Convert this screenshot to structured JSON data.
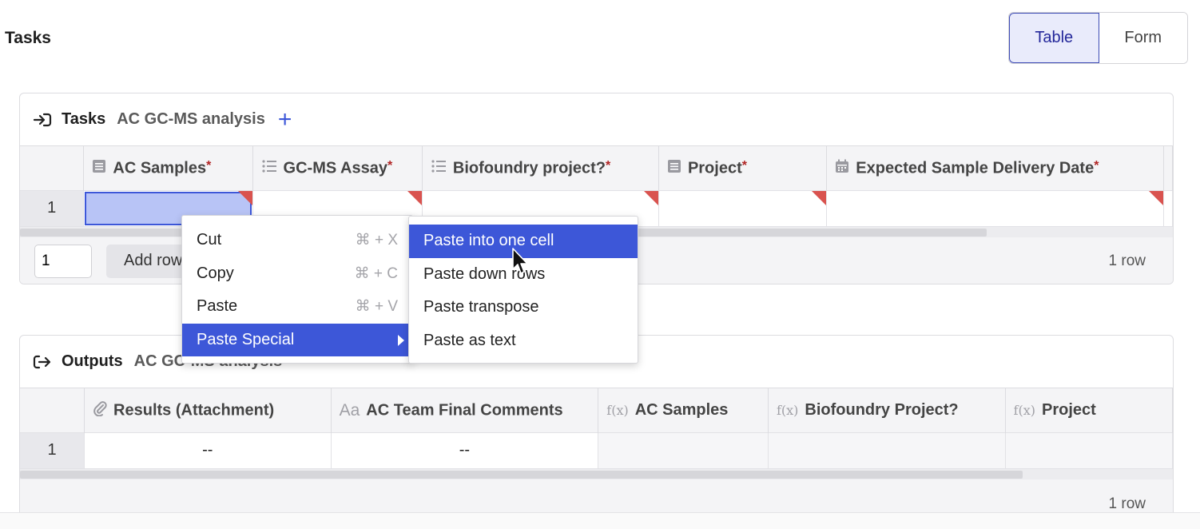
{
  "page": {
    "title": "Tasks"
  },
  "view_toggle": {
    "table_label": "Table",
    "form_label": "Form",
    "active": "Table"
  },
  "tasks_panel": {
    "kind": "Tasks",
    "subtitle": "AC GC-MS analysis",
    "add_symbol": "+",
    "columns": [
      {
        "label": "AC Samples",
        "required": "*",
        "icon": "table-icon"
      },
      {
        "label": "GC-MS Assay",
        "required": "*",
        "icon": "list-icon"
      },
      {
        "label": "Biofoundry project?",
        "required": "*",
        "icon": "list-icon"
      },
      {
        "label": "Project",
        "required": "*",
        "icon": "table-icon"
      },
      {
        "label": "Expected Sample Delivery Date",
        "required": "*",
        "icon": "calendar-icon"
      }
    ],
    "rows": [
      {
        "num": "1"
      }
    ],
    "footer": {
      "count_value": "1",
      "add_rows_label": "Add rows",
      "row_count": "1 row"
    }
  },
  "context_menu": {
    "items": [
      {
        "label": "Cut",
        "shortcut": "⌘ + X"
      },
      {
        "label": "Copy",
        "shortcut": "⌘ + C"
      },
      {
        "label": "Paste",
        "shortcut": "⌘ + V"
      },
      {
        "label": "Paste Special",
        "shortcut": ""
      }
    ],
    "highlighted": "Paste Special"
  },
  "submenu": {
    "items": [
      {
        "label": "Paste into one cell"
      },
      {
        "label": "Paste down rows"
      },
      {
        "label": "Paste transpose"
      },
      {
        "label": "Paste as text"
      }
    ],
    "highlighted": "Paste into one cell"
  },
  "outputs_panel": {
    "kind": "Outputs",
    "subtitle": "AC GC-MS analysis",
    "columns": [
      {
        "label": "Results (Attachment)",
        "icon": "paperclip-icon"
      },
      {
        "label": "AC Team Final Comments",
        "icon": "text-icon",
        "icon_text": "Aa"
      },
      {
        "label": "AC Samples",
        "icon": "formula-icon",
        "icon_text": "f(x)"
      },
      {
        "label": "Biofoundry Project?",
        "icon": "formula-icon",
        "icon_text": "f(x)"
      },
      {
        "label": "Project",
        "icon": "formula-icon",
        "icon_text": "f(x)"
      }
    ],
    "rows": [
      {
        "num": "1",
        "cells": [
          "--",
          "--",
          "",
          "",
          ""
        ]
      }
    ],
    "footer": {
      "row_count": "1 row"
    }
  },
  "colors": {
    "accent": "#3d57d8",
    "required": "#b02323",
    "flag": "#d9534f",
    "selection": "#b8c4f6"
  }
}
